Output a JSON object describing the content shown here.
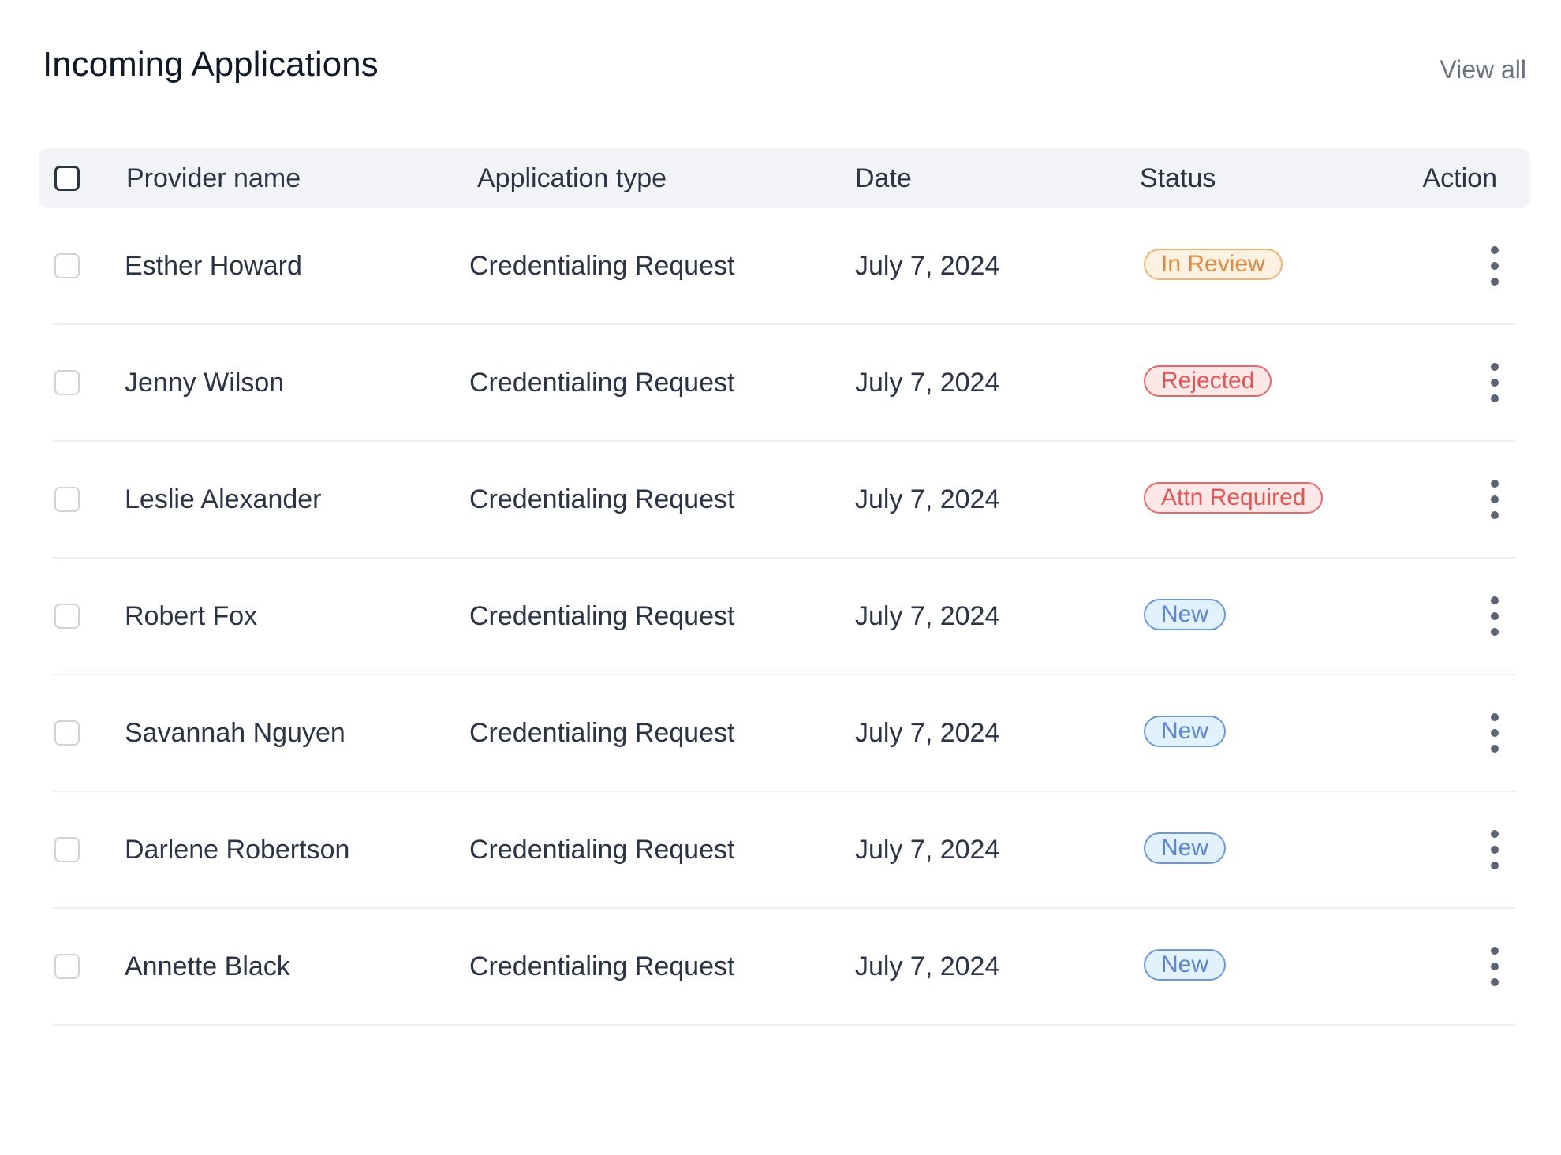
{
  "header": {
    "title": "Incoming Applications",
    "view_all_label": "View all"
  },
  "table": {
    "columns": [
      "Provider name",
      "Application type",
      "Date",
      "Status",
      "Action"
    ],
    "rows": [
      {
        "provider": "Esther Howard",
        "type": "Credentialing Request",
        "date": "July 7, 2024",
        "status": "In Review"
      },
      {
        "provider": "Jenny Wilson",
        "type": "Credentialing Request",
        "date": "July 7, 2024",
        "status": "Rejected"
      },
      {
        "provider": "Leslie Alexander",
        "type": "Credentialing Request",
        "date": "July 7, 2024",
        "status": "Attn Required"
      },
      {
        "provider": "Robert Fox",
        "type": "Credentialing Request",
        "date": "July 7, 2024",
        "status": "New"
      },
      {
        "provider": "Savannah Nguyen",
        "type": "Credentialing Request",
        "date": "July 7, 2024",
        "status": "New"
      },
      {
        "provider": "Darlene Robertson",
        "type": "Credentialing Request",
        "date": "July 7, 2024",
        "status": "New"
      },
      {
        "provider": "Annette Black",
        "type": "Credentialing Request",
        "date": "July 7, 2024",
        "status": "New"
      }
    ]
  },
  "status_styles": {
    "In Review": {
      "bg": "#fdf1e2",
      "border": "#ecb378",
      "text": "#df8a43"
    },
    "Rejected": {
      "bg": "#fde7e7",
      "border": "#e66a6a",
      "text": "#de5656"
    },
    "Attn Required": {
      "bg": "#fde7e7",
      "border": "#e66a6a",
      "text": "#de5656"
    },
    "New": {
      "bg": "#e2f2fc",
      "border": "#6c97d9",
      "text": "#5d86cf"
    }
  },
  "icons": {
    "row_action": "more-vertical-icon"
  }
}
